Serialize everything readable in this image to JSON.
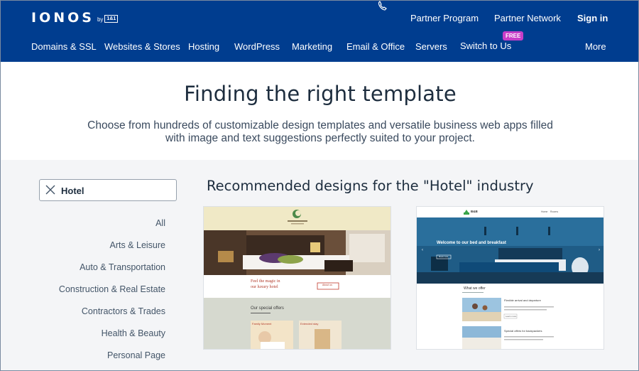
{
  "header": {
    "logo": {
      "word": "IONOS",
      "by": "by",
      "badge": "1&1"
    },
    "top_links": [
      "Partner Program",
      "Partner Network",
      "Sign in"
    ],
    "nav": [
      "Domains & SSL",
      "Websites & Stores",
      "Hosting",
      "WordPress",
      "Marketing",
      "Email & Office",
      "Servers",
      "Switch to Us",
      "More"
    ],
    "free_badge": "FREE"
  },
  "hero": {
    "title": "Finding the right template",
    "subtitle": "Choose from hundreds of customizable design templates and versatile business web apps filled with image and text suggestions perfectly suited to your project."
  },
  "search": {
    "value": "Hotel"
  },
  "categories": [
    "All",
    "Arts & Leisure",
    "Auto & Transportation",
    "Construction & Real Estate",
    "Contractors & Trades",
    "Health & Beauty",
    "Personal Page"
  ],
  "recommended_title": "Recommended designs for the \"Hotel\" industry",
  "card1": {
    "tagline_1": "Feel the magic in",
    "tagline_2": "our luxury hotel",
    "button": "About us",
    "section": "Our special offers",
    "offer_1": "Family Moment",
    "offer_2": "Extended stay"
  },
  "card2": {
    "brand": "B&B",
    "nav_1": "Home",
    "nav_2": "Rooms",
    "hero_text": "Welcome to our bed and breakfast",
    "hero_button": "Book now",
    "section": "What we offer",
    "item_1": "Flexible arrival and departure",
    "item_1_button": "Learn more",
    "item_2": "Special offers for backpackers"
  }
}
